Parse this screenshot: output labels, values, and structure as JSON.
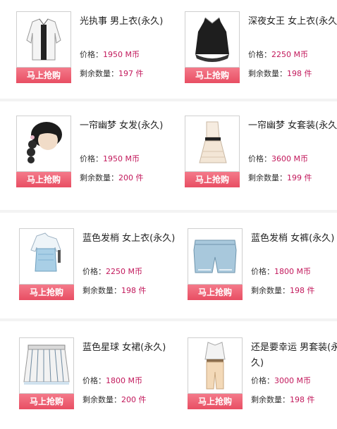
{
  "buy_label": "马上抢购",
  "price_label": "价格：",
  "currency": "M币",
  "stock_label": "剩余数量：",
  "stock_unit": "件",
  "items": [
    {
      "name": "光执事 男上衣(永久)",
      "price": "1950",
      "stock": "197",
      "icon": "white-jacket-icon"
    },
    {
      "name": "深夜女王 女上衣(永久)",
      "price": "2250",
      "stock": "198",
      "icon": "black-dress-top-icon"
    },
    {
      "name": "一帘幽梦 女发(永久)",
      "price": "1950",
      "stock": "200",
      "icon": "braided-hair-icon"
    },
    {
      "name": "一帘幽梦 女套装(永久)",
      "price": "3600",
      "stock": "199",
      "icon": "white-dress-icon"
    },
    {
      "name": "蓝色发梢 女上衣(永久)",
      "price": "2250",
      "stock": "198",
      "icon": "blue-top-icon"
    },
    {
      "name": "蓝色发梢 女裤(永久)",
      "price": "1800",
      "stock": "198",
      "icon": "denim-shorts-icon"
    },
    {
      "name": "蓝色星球 女裙(永久)",
      "price": "1800",
      "stock": "200",
      "icon": "striped-skirt-icon"
    },
    {
      "name": "还是要幸运 男套装(永久)",
      "price": "3000",
      "stock": "198",
      "icon": "mens-outfit-icon"
    }
  ]
}
